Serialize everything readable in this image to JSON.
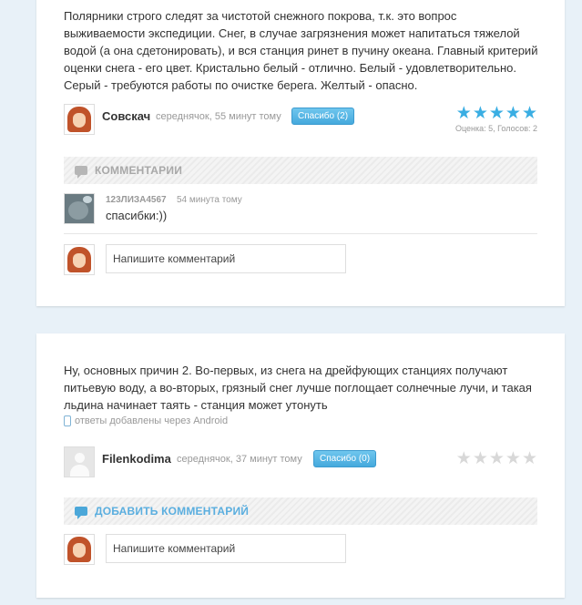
{
  "answers": [
    {
      "text": "Полярники строго следят за чистотой снежного покрова, т.к. это вопрос выживаемости экспедиции. Снег, в случае загрязнения может напитаться тяжелой водой (а она сдетонировать), и вся станция ринет в пучину океана. Главный критерий оценки снега - его цвет. Кристально белый - отлично. Белый - удовлетворительно. Серый - требуются работы по очистке берега. Желтый - опасно.",
      "author": "Совскач",
      "meta": "середнячок, 55 минут тому",
      "thanks_label": "Спасибо (2)",
      "rating": 5,
      "rating_info": "Оценка: 5, Голосов: 2",
      "comments_title": "КОММЕНТАРИИ",
      "comments": [
        {
          "user": "123ЛИЗА4567",
          "time": "54 минута тому",
          "text": "спасибки:))"
        }
      ],
      "input_placeholder": "Напишите комментарий"
    },
    {
      "text": "Ну, основных причин 2. Во-первых, из снега на дрейфующих станциях получают питьевую воду, а во-вторых, грязный снег лучше поглощает солнечные лучи, и такая льдина начинает таять - станция может утонуть",
      "via": "ответы добавлены через Android",
      "author": "Filenkodima",
      "meta": "середнячок, 37 минут тому",
      "thanks_label": "Спасибо (0)",
      "rating": 0,
      "comments_title": "ДОБАВИТЬ КОММЕНТАРИЙ",
      "input_placeholder": "Напишите комментарий"
    }
  ],
  "colors": {
    "accent": "#3aaee3",
    "star_empty": "#d8d8d8",
    "background": "#e8f1f8"
  }
}
